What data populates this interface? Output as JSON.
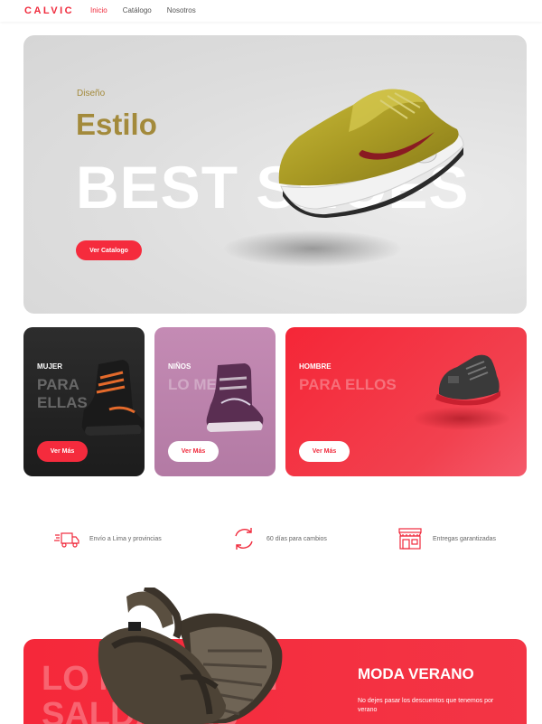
{
  "header": {
    "logo": "CALVIC",
    "nav": [
      {
        "label": "Inicio",
        "active": true
      },
      {
        "label": "Catálogo",
        "active": false
      },
      {
        "label": "Nosotros",
        "active": false
      }
    ]
  },
  "hero": {
    "eyebrow": "Diseño",
    "title": "Estilo",
    "big_text": "BEST SHOES",
    "button": "Ver Catalogo"
  },
  "categories": [
    {
      "label": "MUJER",
      "ghost": "PARA ELLAS",
      "button": "Ver Más"
    },
    {
      "label": "NIÑOS",
      "ghost": "LO MEJOR",
      "button": "Ver Más"
    },
    {
      "label": "HOMBRE",
      "ghost": "PARA ELLOS",
      "button": "Ver Más"
    }
  ],
  "features": [
    {
      "icon": "delivery-truck-icon",
      "text": "Envío a Lima y provincias"
    },
    {
      "icon": "exchange-cycle-icon",
      "text": "60 días para cambios"
    },
    {
      "icon": "store-icon",
      "text": "Entregas garantizadas"
    }
  ],
  "promo": {
    "ghost": "LO MEJOR EN\nSALDALIAS",
    "title": "MODA VERANO",
    "description": "No dejes pasar los descuentos que tenemos por verano"
  },
  "colors": {
    "brand_red": "#f02a3c",
    "gold": "#a38a3b",
    "hero_bg": "#dedede"
  }
}
